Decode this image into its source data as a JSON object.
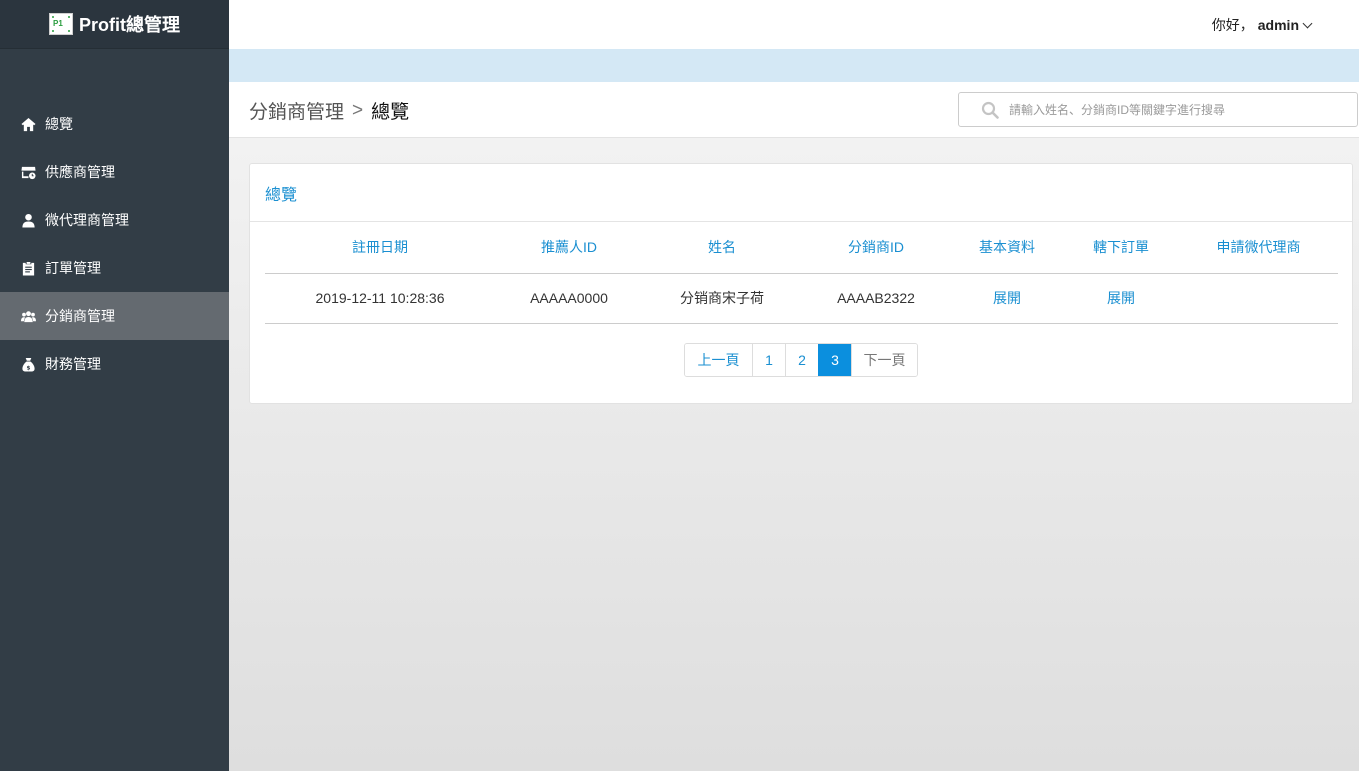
{
  "brand": {
    "logo_text": "P1",
    "title": "Profit總管理"
  },
  "sidebar": {
    "items": [
      {
        "label": "總覽",
        "icon": "home-icon"
      },
      {
        "label": "供應商管理",
        "icon": "store-icon"
      },
      {
        "label": "微代理商管理",
        "icon": "user-icon"
      },
      {
        "label": "訂單管理",
        "icon": "clipboard-icon"
      },
      {
        "label": "分銷商管理",
        "icon": "users-icon",
        "active": true
      },
      {
        "label": "財務管理",
        "icon": "money-bag-icon"
      }
    ]
  },
  "header": {
    "greeting": "你好，",
    "username": "admin"
  },
  "breadcrumb": {
    "parent": "分銷商管理",
    "separator": ">",
    "current": "總覽"
  },
  "search": {
    "placeholder": "請輸入姓名、分銷商ID等關鍵字進行搜尋",
    "value": ""
  },
  "panel": {
    "title": "總覽",
    "columns": [
      "註冊日期",
      "推薦人ID",
      "姓名",
      "分銷商ID",
      "基本資料",
      "轄下訂單",
      "申請微代理商"
    ],
    "rows": [
      [
        "2019-12-11 10:28:36",
        "AAAAA0000",
        "分销商宋子荷",
        "AAAAB2322",
        "展開",
        "展開",
        ""
      ]
    ]
  },
  "pagination": {
    "prev": "上一頁",
    "pages": [
      "1",
      "2",
      "3"
    ],
    "current": "3",
    "next": "下一頁"
  },
  "colors": {
    "sidebar_bg": "#323d46",
    "active_item_bg": "#646a70",
    "accent": "#1a8fd1",
    "active_page": "#0b8fde",
    "blue_band": "#d4e8f5"
  }
}
